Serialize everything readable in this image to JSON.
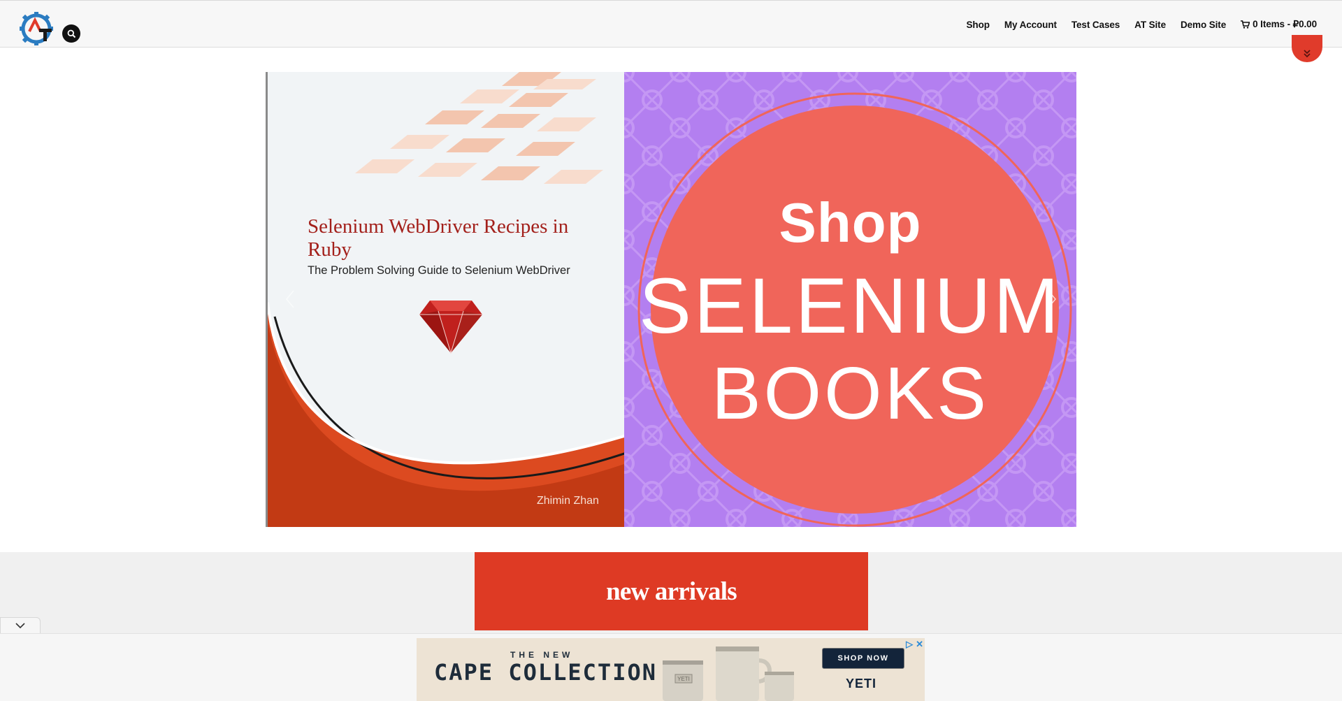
{
  "nav": {
    "items": [
      "Shop",
      "My Account",
      "Test Cases",
      "AT Site",
      "Demo Site"
    ],
    "cart_label": "0 Items - ₽0.00"
  },
  "slider": {
    "book": {
      "title": "Selenium WebDriver Recipes in Ruby",
      "subtitle": "The Problem Solving Guide to Selenium WebDriver",
      "author": "Zhimin Zhan"
    },
    "promo": {
      "line1": "Shop",
      "line2": "SELENIUM",
      "line3": "BOOKS"
    }
  },
  "section": {
    "new_arrivals": "new arrivals"
  },
  "ad": {
    "tagline": "THE NEW",
    "headline": "CAPE COLLECTION",
    "button": "SHOP NOW",
    "brand": "YETI",
    "cup_label": "YETI"
  },
  "colors": {
    "accent_red": "#de3a24",
    "promo_purple": "#b37ff0",
    "promo_circle": "#f0655a",
    "ad_navy": "#13243a"
  }
}
